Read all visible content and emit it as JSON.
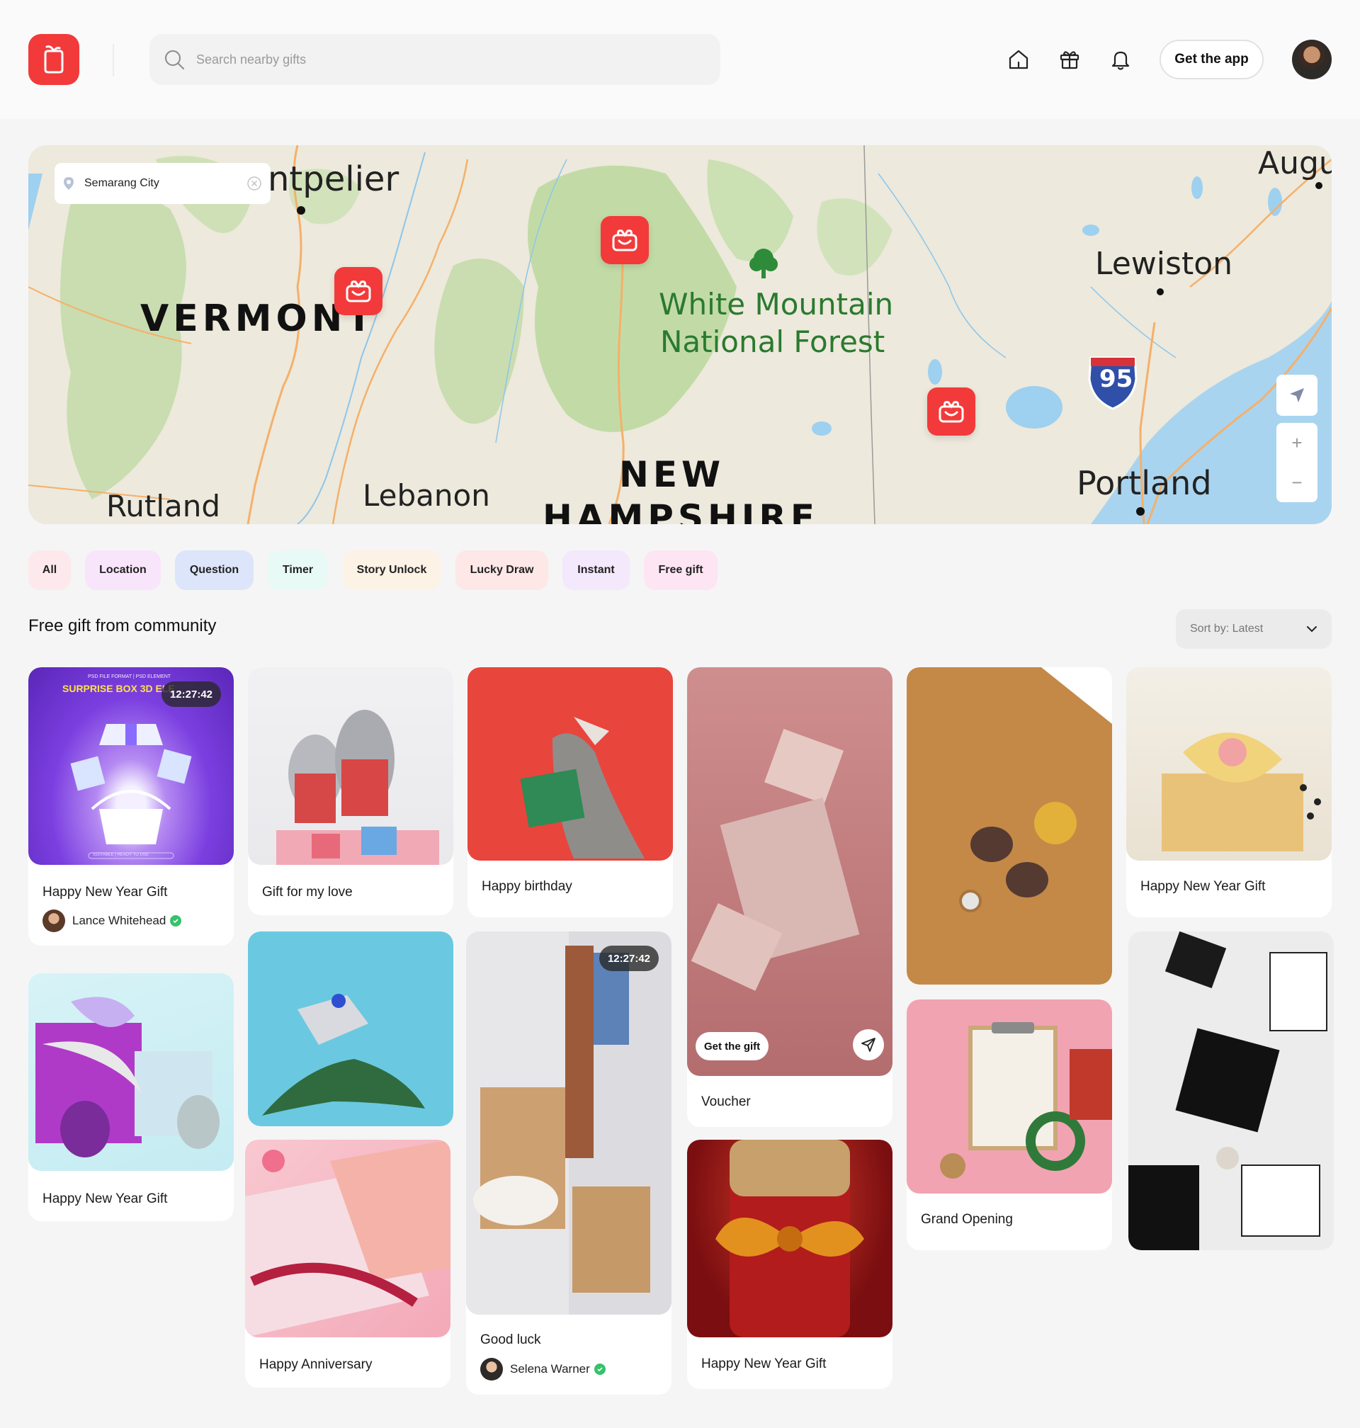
{
  "header": {
    "search_placeholder": "Search nearby gifts",
    "get_app_label": "Get the app",
    "icons": [
      "home-icon",
      "gift-icon",
      "bell-icon"
    ]
  },
  "map": {
    "location_value": "Semarang City",
    "labels": {
      "montpelier": "ntpelier",
      "vermont": "VERMONT",
      "white_mountain": "White Mountain",
      "national_forest": "National Forest",
      "augu": "Augu",
      "lewiston": "Lewiston",
      "interstate": "95",
      "rutland": "Rutland",
      "lebanon": "Lebanon",
      "new": "NEW",
      "hampshire": "HAMPSHIRE",
      "portland": "Portland"
    },
    "zoom_in": "+",
    "zoom_out": "−"
  },
  "filters": [
    {
      "label": "All",
      "color": "#fde9ec"
    },
    {
      "label": "Location",
      "color": "#f9e5fb"
    },
    {
      "label": "Question",
      "color": "#dde5fb"
    },
    {
      "label": "Timer",
      "color": "#e8faf5"
    },
    {
      "label": "Story Unlock",
      "color": "#fcf2e5"
    },
    {
      "label": "Lucky Draw",
      "color": "#fde7e7"
    },
    {
      "label": "Instant",
      "color": "#f4e8fc"
    },
    {
      "label": "Free gift",
      "color": "#fde5f4"
    }
  ],
  "section": {
    "title": "Free gift from community",
    "sort_label": "Sort by: Latest"
  },
  "cards": [
    {
      "title": "Happy New Year Gift",
      "timer": "12:27:42",
      "author": "Lance Whitehead",
      "banner_title": "SURPRISE BOX 3D ELE",
      "banner_top": "PSD FILE FORMAT | PSD ELEMENT",
      "banner_bottom": "EDITABLE | READY TO USE"
    },
    {
      "title": "Gift for my love"
    },
    {
      "title": "Happy birthday"
    },
    {
      "title": "Voucher",
      "action": "Get the gift"
    },
    {
      "title": ""
    },
    {
      "title": "Happy New Year Gift"
    },
    {
      "title": "Happy New Year Gift"
    },
    {
      "title": ""
    },
    {
      "title": "Good luck",
      "timer": "12:27:42",
      "author": "Selena Warner"
    },
    {
      "title": "Grand Opening"
    },
    {
      "title": ""
    },
    {
      "title": "Happy Anniversary"
    },
    {
      "title": "Happy New Year Gift"
    }
  ],
  "colors": {
    "accent": "#f23a3a",
    "verified": "#35c26c"
  }
}
